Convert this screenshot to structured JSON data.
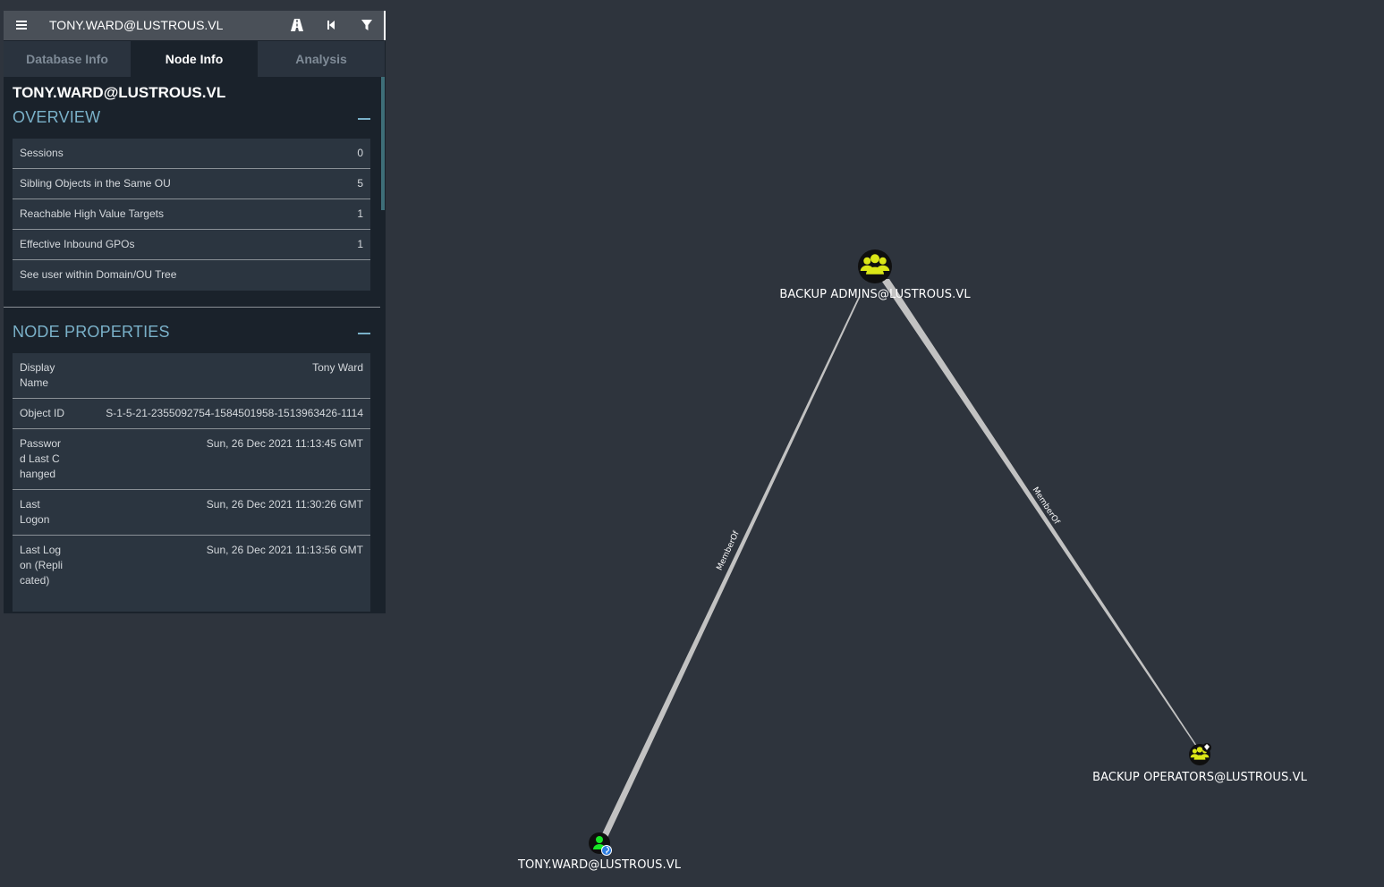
{
  "search": {
    "query": "TONY.WARD@LUSTROUS.VL"
  },
  "toolbar": {
    "menu_icon": "hamburger-icon",
    "pathfinding_icon": "road-icon",
    "back_icon": "step-back-icon",
    "filter_icon": "filter-icon"
  },
  "tabs": [
    {
      "label": "Database Info",
      "active": false
    },
    {
      "label": "Node Info",
      "active": true
    },
    {
      "label": "Analysis",
      "active": false
    }
  ],
  "node_info": {
    "title": "TONY.WARD@LUSTROUS.VL",
    "overview": {
      "heading": "OVERVIEW",
      "rows": [
        {
          "label": "Sessions",
          "value": "0"
        },
        {
          "label": "Sibling Objects in the Same OU",
          "value": "5"
        },
        {
          "label": "Reachable High Value Targets",
          "value": "1"
        },
        {
          "label": "Effective Inbound GPOs",
          "value": "1"
        },
        {
          "label": "See user within Domain/OU Tree",
          "value": ""
        }
      ]
    },
    "properties": {
      "heading": "NODE PROPERTIES",
      "rows": [
        {
          "label": "Display Name",
          "value": "Tony Ward"
        },
        {
          "label": "Object ID",
          "value": "S-1-5-21-2355092754-1584501958-1513963426-1114"
        },
        {
          "label": "Password Last Changed",
          "value": "Sun, 26 Dec 2021 11:13:45 GMT"
        },
        {
          "label": "Last Logon",
          "value": "Sun, 26 Dec 2021 11:30:26 GMT"
        },
        {
          "label": "Last Logon (Replicated)",
          "value": "Sun, 26 Dec 2021 11:13:56 GMT"
        }
      ]
    }
  },
  "graph": {
    "nodes": [
      {
        "id": "backup-admins",
        "label": "BACKUP ADMINS@LUSTROUS.VL",
        "kind": "group",
        "icon": "group-icon"
      },
      {
        "id": "backup-operators",
        "label": "BACKUP OPERATORS@LUSTROUS.VL",
        "kind": "group",
        "icon": "group-high-value-icon"
      },
      {
        "id": "tony-ward",
        "label": "TONY.WARD@LUSTROUS.VL",
        "kind": "user",
        "icon": "user-owned-icon"
      }
    ],
    "edges": [
      {
        "from": "tony-ward",
        "to": "backup-admins",
        "label": "MemberOf"
      },
      {
        "from": "backup-admins",
        "to": "backup-operators",
        "label": "MemberOf"
      }
    ],
    "colors": {
      "background": "#2e343d",
      "group_fill": "#dbe617",
      "user_fill": "#17e625",
      "edge": "#c8c8c8"
    }
  }
}
